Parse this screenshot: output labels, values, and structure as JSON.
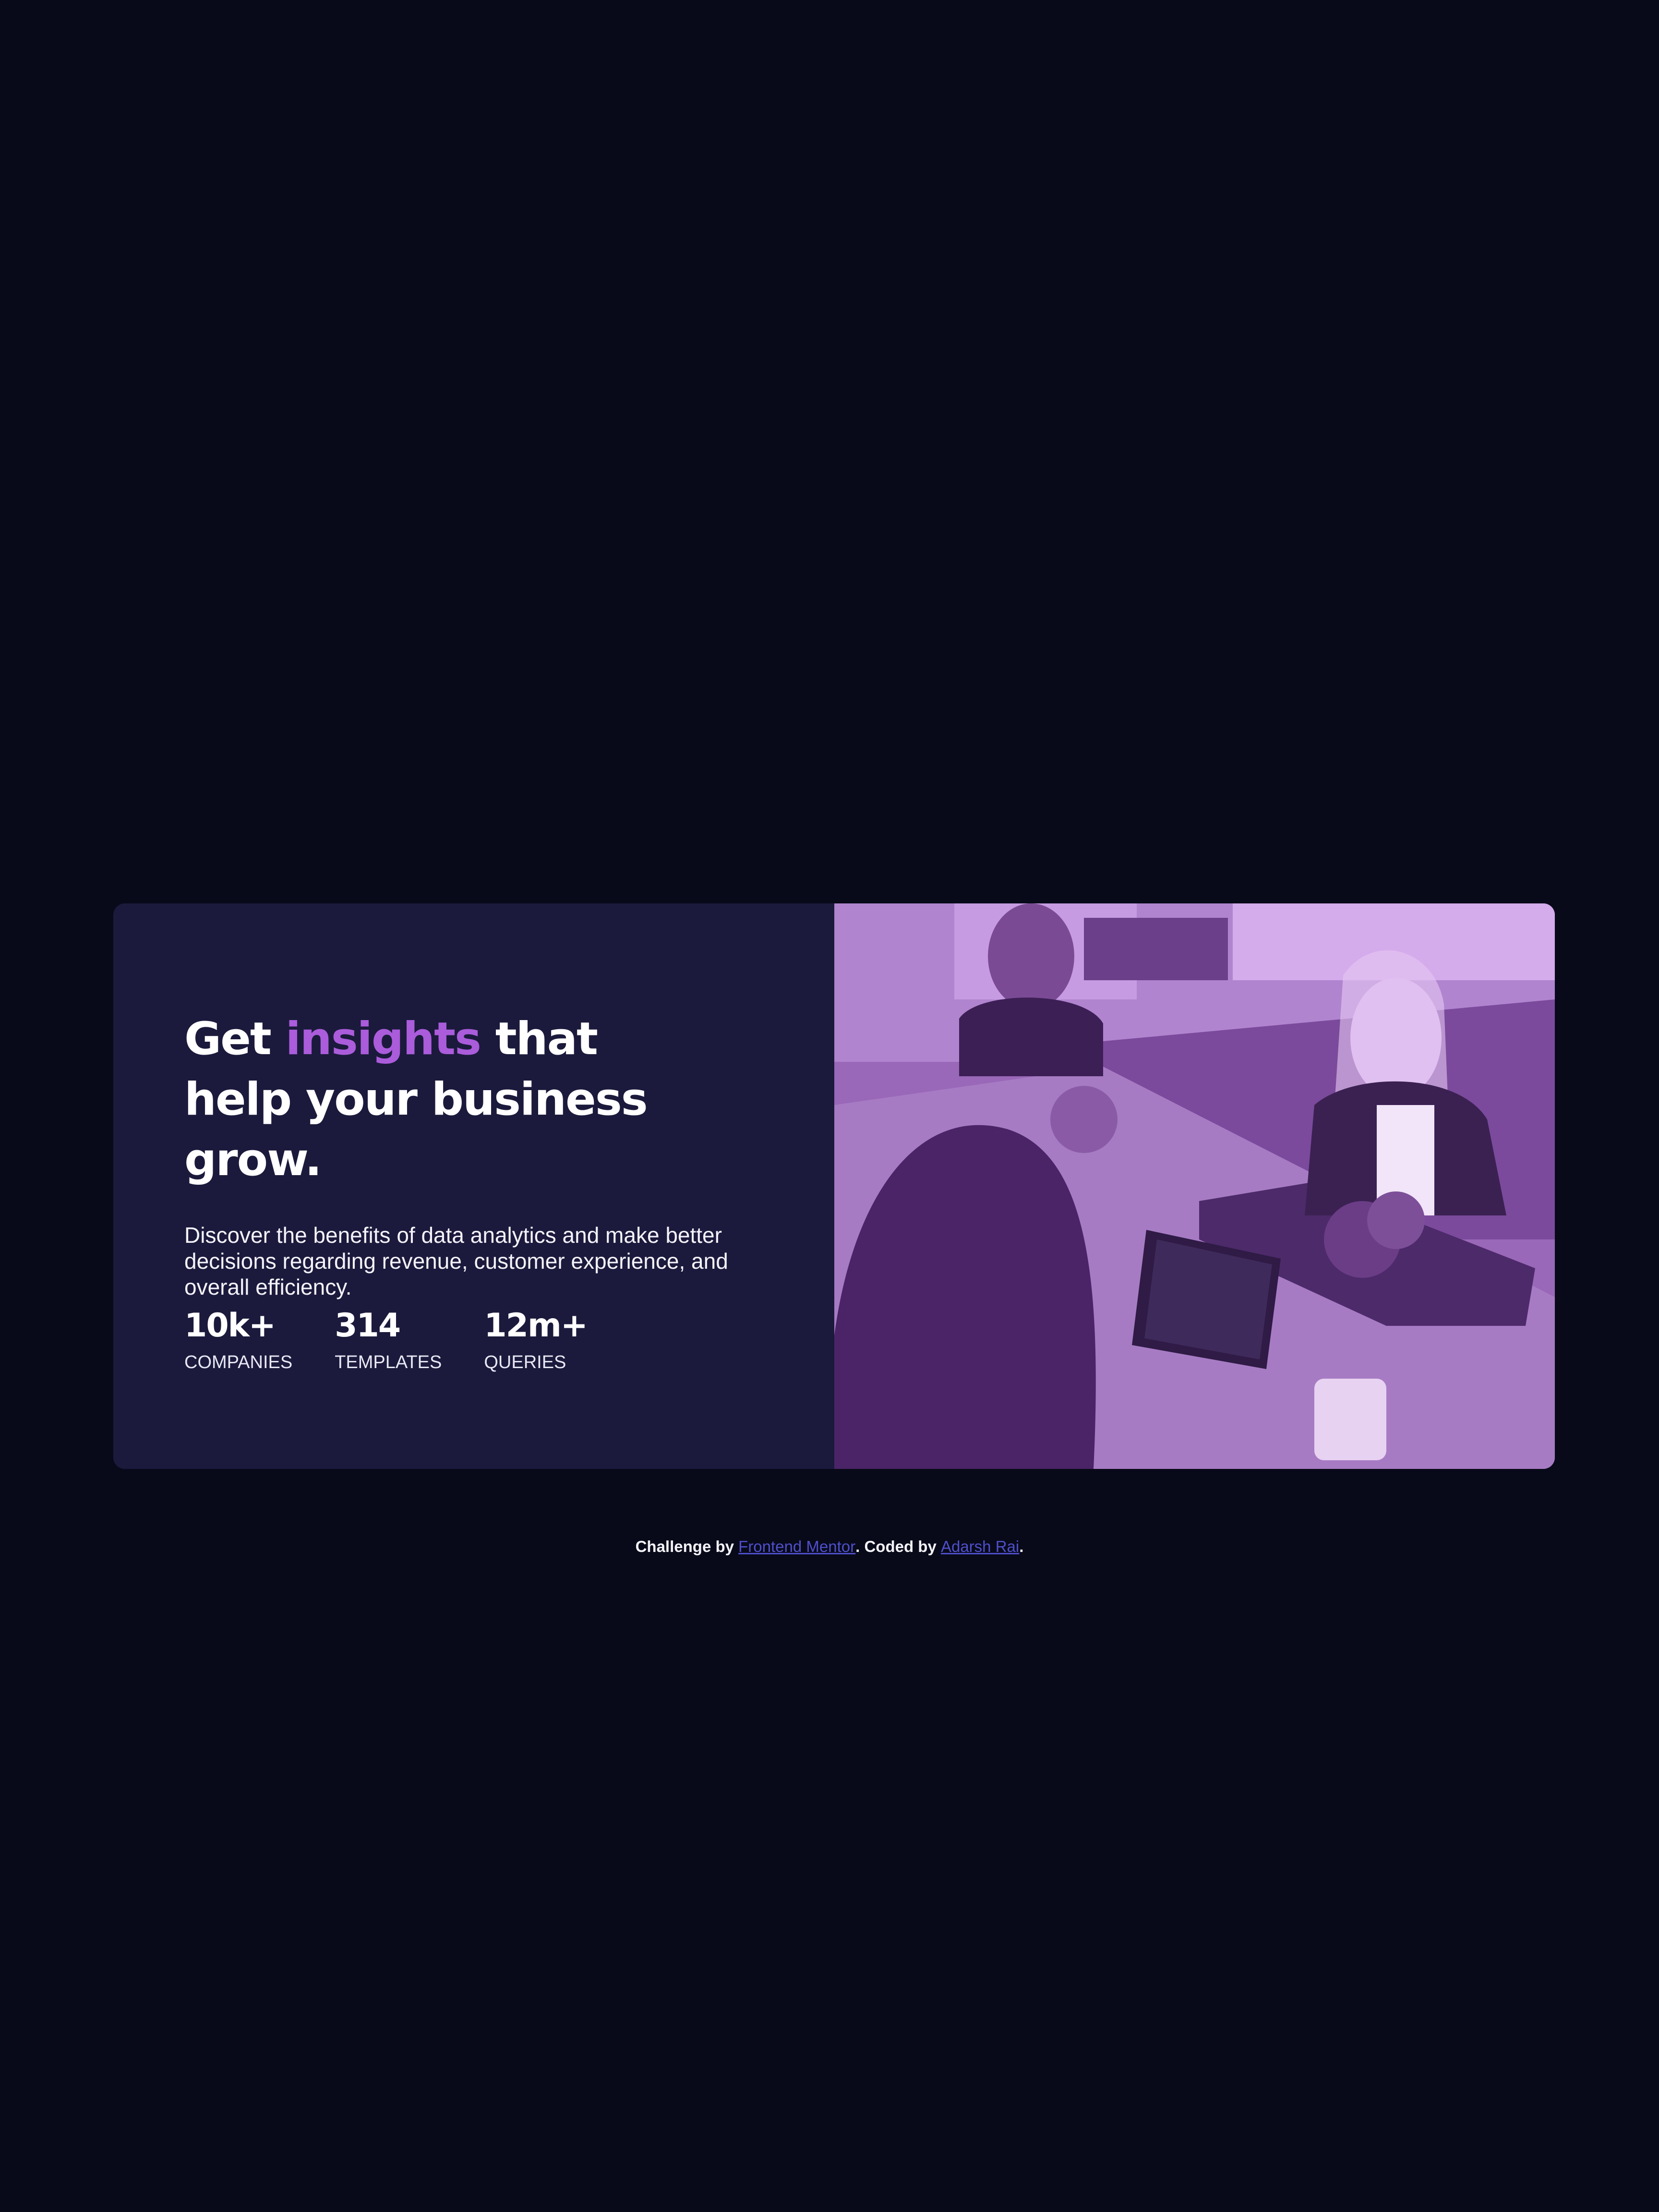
{
  "card": {
    "headline": {
      "prefix": "Get ",
      "accent": "insights",
      "suffix": " that help your business grow."
    },
    "description": "Discover the benefits of data analytics and make better decisions regarding revenue, customer experience, and overall efficiency.",
    "stats": [
      {
        "value": "10k+",
        "label": "COMPANIES"
      },
      {
        "value": "314",
        "label": "TEMPLATES"
      },
      {
        "value": "12m+",
        "label": "QUERIES"
      }
    ],
    "image_icon": "office-team-photo"
  },
  "footer": {
    "challenge_prefix": "Challenge by ",
    "challenge_link": "Frontend Mentor",
    "coded_prefix": ". Coded by ",
    "author_link": "Adarsh Rai",
    "suffix": "."
  },
  "colors": {
    "background": "#080a1a",
    "card": "#1b1a3c",
    "accent": "#aa5cdb",
    "link": "#4f4fcc",
    "image_tint": "#8b5ca8"
  }
}
